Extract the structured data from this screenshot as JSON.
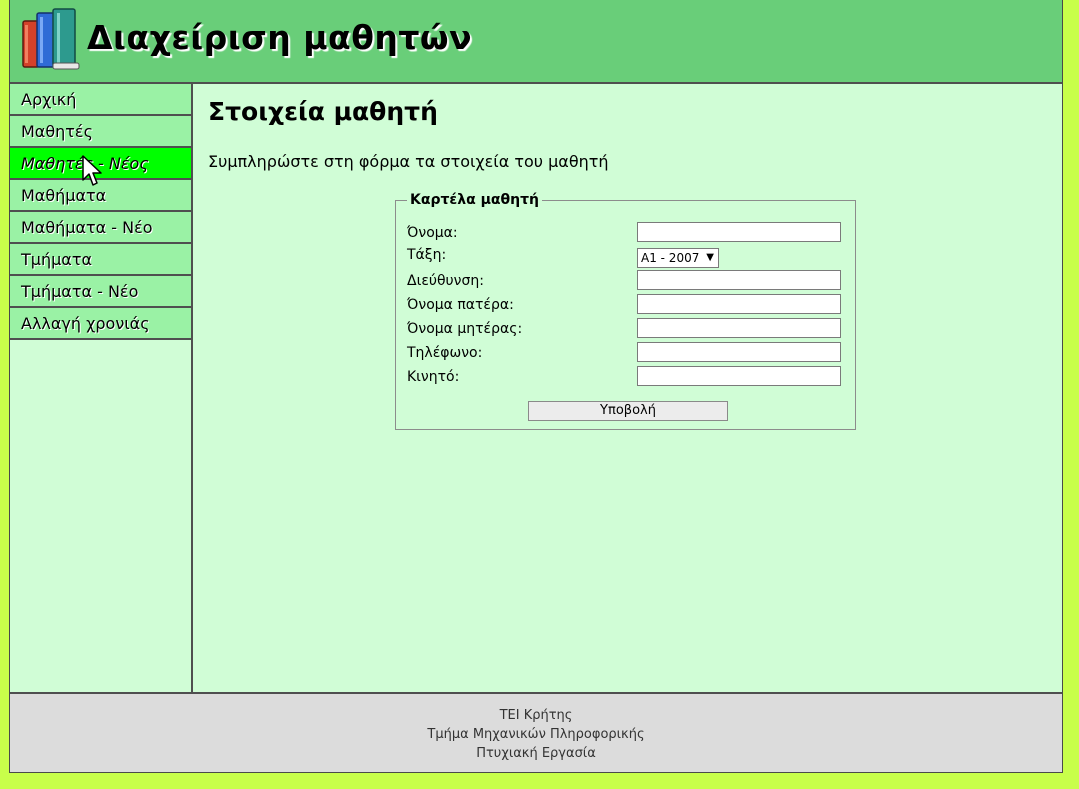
{
  "header": {
    "title": "Διαχείριση μαθητών",
    "logo_icon": "books-icon"
  },
  "sidebar": {
    "items": [
      {
        "label": "Αρχική"
      },
      {
        "label": "Μαθητές"
      },
      {
        "label": "Μαθητές - Νέος",
        "active": true
      },
      {
        "label": "Μαθήματα"
      },
      {
        "label": "Μαθήματα - Νέο"
      },
      {
        "label": "Τμήματα"
      },
      {
        "label": "Τμήματα - Νέο"
      },
      {
        "label": "Αλλαγή χρονιάς"
      }
    ]
  },
  "main": {
    "title": "Στοιχεία μαθητή",
    "intro": "Συμπληρώστε στη φόρμα τα στοιχεία του μαθητή",
    "form": {
      "legend": "Καρτέλα μαθητή",
      "fields": {
        "name": {
          "label": "Όνομα:",
          "value": ""
        },
        "class": {
          "label": "Τάξη:",
          "selected": "A1 - 2007"
        },
        "address": {
          "label": "Διεύθυνση:",
          "value": ""
        },
        "father": {
          "label": "Όνομα πατέρα:",
          "value": ""
        },
        "mother": {
          "label": "Όνομα μητέρας:",
          "value": ""
        },
        "phone": {
          "label": "Τηλέφωνο:",
          "value": ""
        },
        "mobile": {
          "label": "Κινητό:",
          "value": ""
        }
      },
      "submit_label": "Υποβολή"
    }
  },
  "footer": {
    "lines": [
      "ΤΕΙ Κρήτης",
      "Τμήμα Μηχανικών Πληροφορικής",
      "Πτυχιακή Εργασία"
    ]
  },
  "colors": {
    "page_bg": "#c8ff4a",
    "header_bg": "#69ce79",
    "content_bg": "#d0fdd6",
    "nav_bg": "#9af2a5",
    "nav_active_bg": "#00ff00",
    "footer_bg": "#dcdcdc"
  }
}
